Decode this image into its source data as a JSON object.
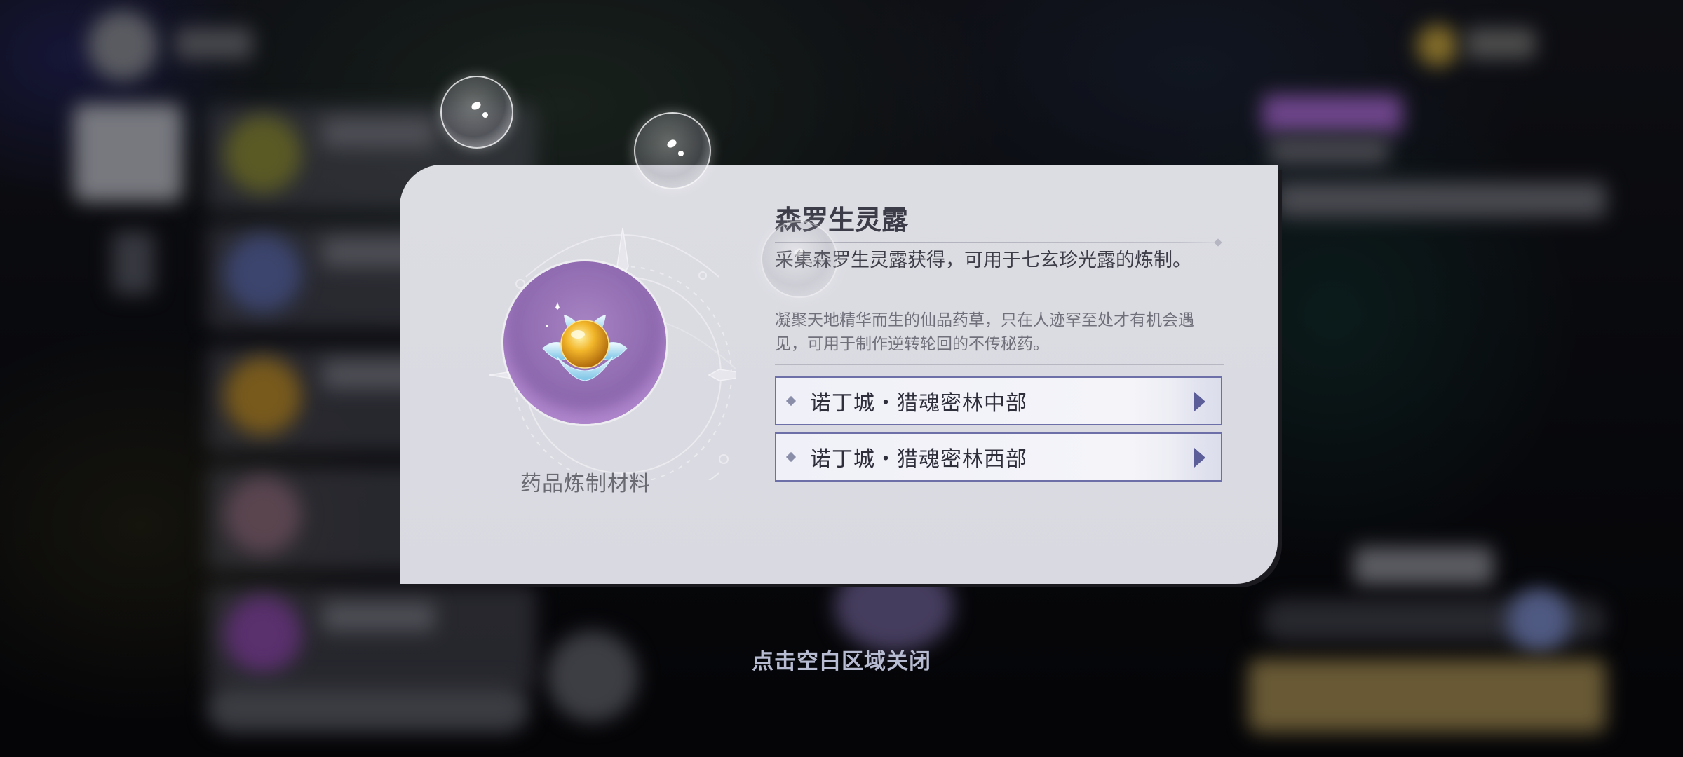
{
  "item": {
    "name": "森罗生灵露",
    "category": "药品炼制材料",
    "description": "采集森罗生灵露获得，可用于七玄珍光露的炼制。",
    "lore": "凝聚天地精华而生的仙品药草，只在人迹罕至处才有机会遇见，可用于制作逆转轮回的不传秘药。",
    "icon": "golden-orb-in-lotus-icon",
    "rarity_color": "#8c67ad"
  },
  "sources": [
    {
      "label": "诺丁城・猎魂密林中部"
    },
    {
      "label": "诺丁城・猎魂密林西部"
    }
  ],
  "close_hint": "点击空白区域关闭",
  "colors": {
    "card_bg": "#dcdce3",
    "accent": "#6d70a8",
    "title": "#3c3c48"
  }
}
